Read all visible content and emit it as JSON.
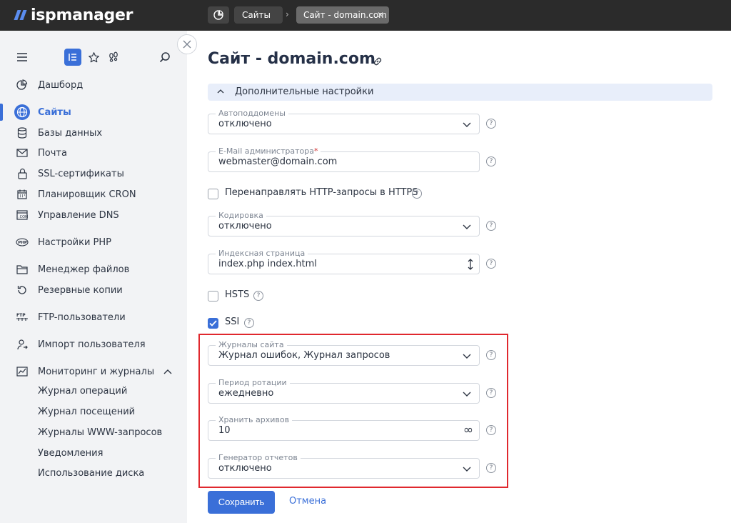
{
  "app": {
    "logo_text": "ispmanager",
    "brand_color": "#3a6fd8"
  },
  "breadcrumbs": {
    "dashboard_icon": "pie-chart-icon",
    "sites_label": "Сайты",
    "current_label": "Сайт - domain.com"
  },
  "sidebar": {
    "tools": [
      "menu-icon",
      "list-icon",
      "star-icon",
      "footprints-icon",
      "search-icon"
    ],
    "items": [
      {
        "label": "Дашборд",
        "icon": "pie-chart-icon"
      },
      {
        "label": "Сайты",
        "icon": "globe-icon",
        "active": true
      },
      {
        "label": "Базы данных",
        "icon": "database-icon"
      },
      {
        "label": "Почта",
        "icon": "mail-icon"
      },
      {
        "label": "SSL-сертификаты",
        "icon": "lock-icon"
      },
      {
        "label": "Планировщик CRON",
        "icon": "calendar-icon"
      },
      {
        "label": "Управление DNS",
        "icon": "dns-icon"
      },
      {
        "label": "Настройки PHP",
        "icon": "php-icon"
      },
      {
        "label": "Менеджер файлов",
        "icon": "folder-icon"
      },
      {
        "label": "Резервные копии",
        "icon": "backup-icon"
      },
      {
        "label": "FTP-пользователи",
        "icon": "ftp-icon"
      },
      {
        "label": "Импорт пользователя",
        "icon": "user-import-icon"
      },
      {
        "label": "Мониторинг и журналы",
        "icon": "chart-icon",
        "expanded": true
      }
    ],
    "subitems": [
      "Журнал операций",
      "Журнал посещений",
      "Журналы WWW-запросов",
      "Уведомления",
      "Использование диска"
    ]
  },
  "main": {
    "title": "Сайт - domain.com",
    "section_title": "Дополнительные настройки",
    "fields": {
      "autosubdomains": {
        "label": "Автоподдомены",
        "value": "отключено"
      },
      "admin_email": {
        "label": "E-Mail администратора",
        "required_mark": "*",
        "value": "webmaster@domain.com"
      },
      "redirect_https": {
        "label": "Перенаправлять HTTP-запросы в HTTPS",
        "checked": false
      },
      "encoding": {
        "label": "Кодировка",
        "value": "отключено"
      },
      "index_page": {
        "label": "Индексная страница",
        "value": "index.php index.html"
      },
      "hsts": {
        "label": "HSTS",
        "checked": false
      },
      "ssi": {
        "label": "SSI",
        "checked": true
      },
      "site_logs": {
        "label": "Журналы сайта",
        "value": "Журнал ошибок, Журнал запросов"
      },
      "rotation_period": {
        "label": "Период ротации",
        "value": "ежедневно"
      },
      "keep_archives": {
        "label": "Хранить архивов",
        "value": "10",
        "suffix": "∞"
      },
      "report_generator": {
        "label": "Генератор отчетов",
        "value": "отключено"
      }
    },
    "help_glyph": "?",
    "save_label": "Сохранить",
    "cancel_label": "Отмена"
  }
}
